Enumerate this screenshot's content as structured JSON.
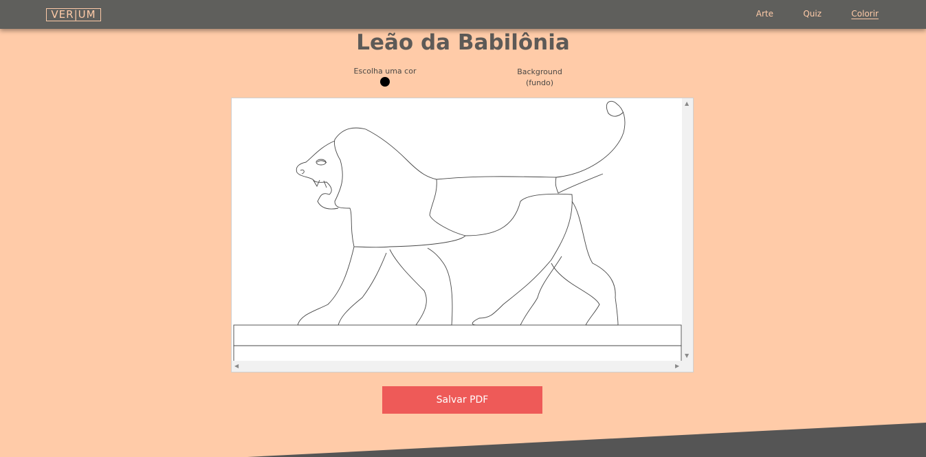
{
  "header": {
    "logo": "VER|UM",
    "nav": [
      {
        "label": "Arte",
        "active": false
      },
      {
        "label": "Quiz",
        "active": false
      },
      {
        "label": "Colorir",
        "active": true
      }
    ]
  },
  "main": {
    "title": "Leão da Babilônia",
    "color_picker_label": "Escolha uma cor",
    "selected_color": "#000000",
    "background_label_line1": "Background",
    "background_label_line2": "(fundo)",
    "save_button": "Salvar PDF"
  },
  "colors": {
    "page_background": "#ffcba8",
    "topbar": "#5f5f5c",
    "accent_text": "#ffcba8",
    "button": "#ee5a58",
    "footer_band": "#555555"
  }
}
